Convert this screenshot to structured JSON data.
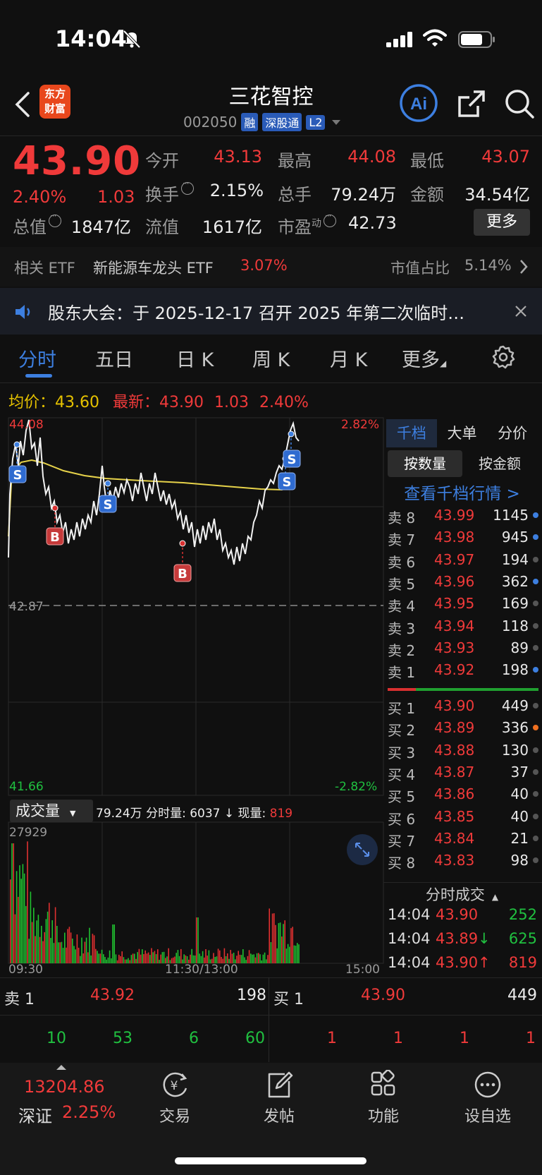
{
  "status": {
    "time": "14:04"
  },
  "header": {
    "title": "三花智控",
    "code": "002050",
    "tags": [
      "融",
      "深股通",
      "L2"
    ],
    "logo_line1": "东方",
    "logo_line2": "财富",
    "ai_label": "Ai"
  },
  "quote": {
    "price": "43.90",
    "pct": "2.40%",
    "change": "1.03",
    "open_label": "今开",
    "open": "43.13",
    "high_label": "最高",
    "high": "44.08",
    "low_label": "最低",
    "low": "43.07",
    "turnover_label": "换手",
    "turnover": "2.15%",
    "volume_label": "总手",
    "volume": "79.24万",
    "amount_label": "金额",
    "amount": "34.54亿",
    "mcap_label": "总值",
    "mcap": "1847亿",
    "float_label": "流值",
    "float": "1617亿",
    "pe_label": "市盈",
    "pe_sup": "动",
    "pe": "42.73",
    "more_label": "更多"
  },
  "etf": {
    "label": "相关 ETF",
    "name": "新能源车龙头 ETF",
    "pct": "3.07%",
    "ratio_label": "市值占比",
    "ratio": "5.14%"
  },
  "notice": {
    "text": "股东大会：于 2025-12-17 召开 2025 年第二次临时…"
  },
  "tabs": [
    "分时",
    "五日",
    "日 K",
    "周 K",
    "月 K",
    "更多"
  ],
  "chart": {
    "avg_label": "均价：",
    "avg": "43.60",
    "latest_label": "最新：",
    "latest": "43.90",
    "latest_chg": "1.03",
    "latest_pct": "2.40%",
    "y_top": "44.08",
    "y_mid": "42.87",
    "y_bottom": "41.66",
    "pct_top": "2.82%",
    "pct_bottom": "-2.82%",
    "vol_selector": "成交量",
    "vol_summary": "79.24万 分时量: 6037 ↓ 现量: ",
    "vol_now": "819",
    "vol_max": "27929",
    "x_labels": [
      "09:30",
      "11:30/13:00",
      "15:00"
    ],
    "marker_s": "S",
    "marker_b": "B"
  },
  "orderbook": {
    "tabs": [
      "千档",
      "大单",
      "分价"
    ],
    "sub_tabs": [
      "按数量",
      "按金额"
    ],
    "link": "查看千档行情 >",
    "asks": [
      {
        "label": "卖 8",
        "price": "43.99",
        "vol": "1145",
        "dot": "#3d7fe0"
      },
      {
        "label": "卖 7",
        "price": "43.98",
        "vol": "945",
        "dot": "#3d7fe0"
      },
      {
        "label": "卖 6",
        "price": "43.97",
        "vol": "194",
        "dot": "#555555"
      },
      {
        "label": "卖 5",
        "price": "43.96",
        "vol": "362",
        "dot": "#3d7fe0"
      },
      {
        "label": "卖 4",
        "price": "43.95",
        "vol": "169",
        "dot": "#555555"
      },
      {
        "label": "卖 3",
        "price": "43.94",
        "vol": "118",
        "dot": "#555555"
      },
      {
        "label": "卖 2",
        "price": "43.93",
        "vol": "89",
        "dot": "#555555"
      },
      {
        "label": "卖 1",
        "price": "43.92",
        "vol": "198",
        "dot": "#3d7fe0"
      }
    ],
    "bids": [
      {
        "label": "买 1",
        "price": "43.90",
        "vol": "449",
        "dot": "#555555"
      },
      {
        "label": "买 2",
        "price": "43.89",
        "vol": "336",
        "dot": "#f07020"
      },
      {
        "label": "买 3",
        "price": "43.88",
        "vol": "130",
        "dot": "#555555"
      },
      {
        "label": "买 4",
        "price": "43.87",
        "vol": "37",
        "dot": "#555555"
      },
      {
        "label": "买 5",
        "price": "43.86",
        "vol": "40",
        "dot": "#555555"
      },
      {
        "label": "买 6",
        "price": "43.85",
        "vol": "40",
        "dot": "#555555"
      },
      {
        "label": "买 7",
        "price": "43.84",
        "vol": "21",
        "dot": "#555555"
      },
      {
        "label": "买 8",
        "price": "43.83",
        "vol": "98",
        "dot": "#555555"
      }
    ],
    "ticks_title": "分时成交",
    "ticks": [
      {
        "time": "14:04",
        "price": "43.90",
        "arrow": "",
        "vol": "252",
        "vcolor": "green"
      },
      {
        "time": "14:04",
        "price": "43.89",
        "arrow": "↓",
        "vol": "625",
        "vcolor": "green"
      },
      {
        "time": "14:04",
        "price": "43.90",
        "arrow": "↑",
        "vol": "819",
        "vcolor": "red"
      }
    ]
  },
  "bottom": {
    "sell1_label": "卖 1",
    "sell1_price": "43.92",
    "sell1_vol": "198",
    "buy1_label": "买 1",
    "buy1_price": "43.90",
    "buy1_vol": "449",
    "sell_queue": [
      "10",
      "53",
      "6",
      "60"
    ],
    "buy_queue": [
      "1",
      "1",
      "1",
      "1"
    ]
  },
  "nav": {
    "index_value": "13204.86",
    "index_name": "深证",
    "index_pct": "2.25%",
    "items": [
      "交易",
      "发帖",
      "功能",
      "设自选"
    ]
  }
}
